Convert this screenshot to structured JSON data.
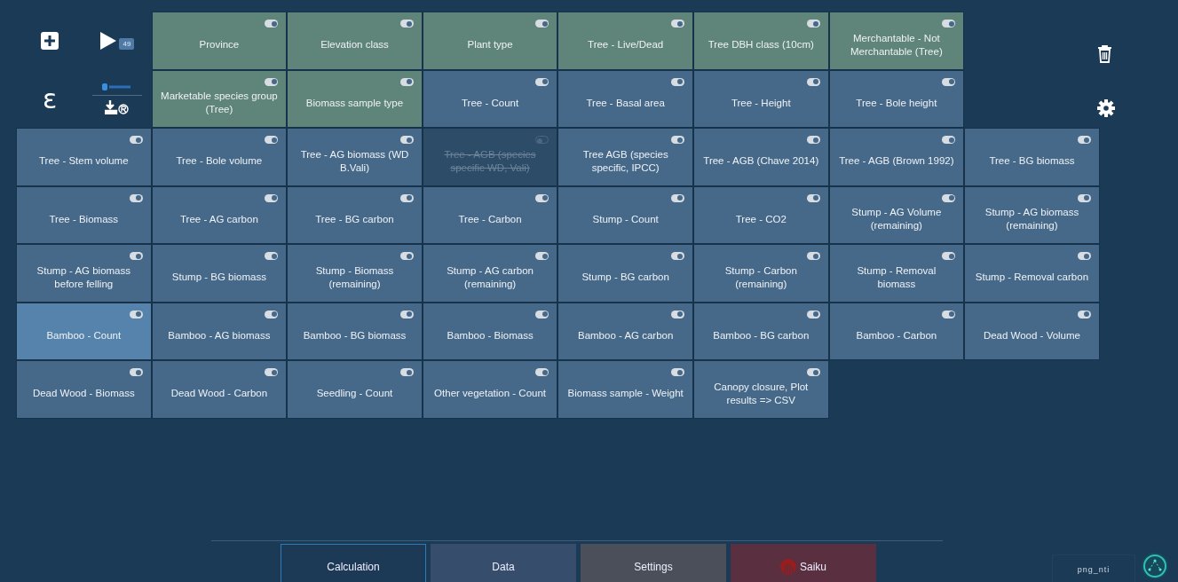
{
  "toolbar": {
    "run_count": "49",
    "logo": "ɛ"
  },
  "top_cards": [
    {
      "label": "Province",
      "kind": "category",
      "on": true,
      "selected": false
    },
    {
      "label": "Elevation class",
      "kind": "category",
      "on": true,
      "selected": false
    },
    {
      "label": "Plant type",
      "kind": "category",
      "on": true,
      "selected": false
    },
    {
      "label": "Tree - Live/Dead",
      "kind": "category",
      "on": true,
      "selected": false
    },
    {
      "label": "Tree DBH class (10cm)",
      "kind": "category",
      "on": true,
      "selected": false
    },
    {
      "label": "Merchantable - Not Merchantable (Tree)",
      "kind": "category",
      "on": true,
      "selected": false
    },
    {
      "label": "Marketable species group (Tree)",
      "kind": "category",
      "on": true,
      "selected": false
    },
    {
      "label": "Biomass sample type",
      "kind": "category",
      "on": true,
      "selected": false
    },
    {
      "label": "Tree - Count",
      "kind": "measure",
      "on": true,
      "selected": false
    },
    {
      "label": "Tree - Basal area",
      "kind": "measure",
      "on": true,
      "selected": false
    },
    {
      "label": "Tree - Height",
      "kind": "measure",
      "on": true,
      "selected": false
    },
    {
      "label": "Tree - Bole height",
      "kind": "measure",
      "on": true,
      "selected": false
    }
  ],
  "cards": [
    {
      "label": "Tree - Stem volume",
      "kind": "measure",
      "on": true,
      "selected": false
    },
    {
      "label": "Tree - Bole volume",
      "kind": "measure",
      "on": true,
      "selected": false
    },
    {
      "label": "Tree - AG biomass (WD B.Vali)",
      "kind": "measure",
      "on": true,
      "selected": false
    },
    {
      "label": "Tree - AGB (species specific WD, Vali)",
      "kind": "measure",
      "on": false,
      "selected": false
    },
    {
      "label": "Tree AGB (species specific, IPCC)",
      "kind": "measure",
      "on": true,
      "selected": false
    },
    {
      "label": "Tree - AGB (Chave 2014)",
      "kind": "measure",
      "on": true,
      "selected": false
    },
    {
      "label": "Tree - AGB (Brown 1992)",
      "kind": "measure",
      "on": true,
      "selected": false
    },
    {
      "label": "Tree - BG biomass",
      "kind": "measure",
      "on": true,
      "selected": false
    },
    {
      "label": "Tree - Biomass",
      "kind": "measure",
      "on": true,
      "selected": false
    },
    {
      "label": "Tree - AG carbon",
      "kind": "measure",
      "on": true,
      "selected": false
    },
    {
      "label": "Tree - BG carbon",
      "kind": "measure",
      "on": true,
      "selected": false
    },
    {
      "label": "Tree - Carbon",
      "kind": "measure",
      "on": true,
      "selected": false
    },
    {
      "label": "Stump - Count",
      "kind": "measure",
      "on": true,
      "selected": false
    },
    {
      "label": "Tree - CO2",
      "kind": "measure",
      "on": true,
      "selected": false
    },
    {
      "label": "Stump - AG Volume (remaining)",
      "kind": "measure",
      "on": true,
      "selected": false
    },
    {
      "label": "Stump - AG biomass (remaining)",
      "kind": "measure",
      "on": true,
      "selected": false
    },
    {
      "label": "Stump - AG biomass before felling",
      "kind": "measure",
      "on": true,
      "selected": false
    },
    {
      "label": "Stump - BG biomass",
      "kind": "measure",
      "on": true,
      "selected": false
    },
    {
      "label": "Stump - Biomass (remaining)",
      "kind": "measure",
      "on": true,
      "selected": false
    },
    {
      "label": "Stump - AG carbon (remaining)",
      "kind": "measure",
      "on": true,
      "selected": false
    },
    {
      "label": "Stump - BG carbon",
      "kind": "measure",
      "on": true,
      "selected": false
    },
    {
      "label": "Stump - Carbon (remaining)",
      "kind": "measure",
      "on": true,
      "selected": false
    },
    {
      "label": "Stump - Removal biomass",
      "kind": "measure",
      "on": true,
      "selected": false
    },
    {
      "label": "Stump - Removal carbon",
      "kind": "measure",
      "on": true,
      "selected": false
    },
    {
      "label": "Bamboo - Count",
      "kind": "measure",
      "on": true,
      "selected": true
    },
    {
      "label": "Bamboo - AG biomass",
      "kind": "measure",
      "on": true,
      "selected": false
    },
    {
      "label": "Bamboo - BG biomass",
      "kind": "measure",
      "on": true,
      "selected": false
    },
    {
      "label": "Bamboo - Biomass",
      "kind": "measure",
      "on": true,
      "selected": false
    },
    {
      "label": "Bamboo - AG carbon",
      "kind": "measure",
      "on": true,
      "selected": false
    },
    {
      "label": "Bamboo - BG carbon",
      "kind": "measure",
      "on": true,
      "selected": false
    },
    {
      "label": "Bamboo - Carbon",
      "kind": "measure",
      "on": true,
      "selected": false
    },
    {
      "label": "Dead Wood - Volume",
      "kind": "measure",
      "on": true,
      "selected": false
    },
    {
      "label": "Dead Wood - Biomass",
      "kind": "measure",
      "on": true,
      "selected": false
    },
    {
      "label": "Dead Wood - Carbon",
      "kind": "measure",
      "on": true,
      "selected": false
    },
    {
      "label": "Seedling - Count",
      "kind": "measure",
      "on": true,
      "selected": false
    },
    {
      "label": "Other vegetation - Count",
      "kind": "measure",
      "on": true,
      "selected": false
    },
    {
      "label": "Biomass sample - Weight",
      "kind": "measure",
      "on": true,
      "selected": false
    },
    {
      "label": "Canopy closure, Plot results => CSV",
      "kind": "measure",
      "on": true,
      "selected": false
    }
  ],
  "tabs": [
    {
      "label": "Calculation",
      "selected": true,
      "color": "#1c3a55"
    },
    {
      "label": "Data",
      "selected": false,
      "color": "#364d6b"
    },
    {
      "label": "Settings",
      "selected": false,
      "color": "#4a4f5a"
    },
    {
      "label": "Saiku",
      "selected": false,
      "color": "#5a3040",
      "kind": "saiku"
    }
  ],
  "status": {
    "label": "png_nti"
  }
}
